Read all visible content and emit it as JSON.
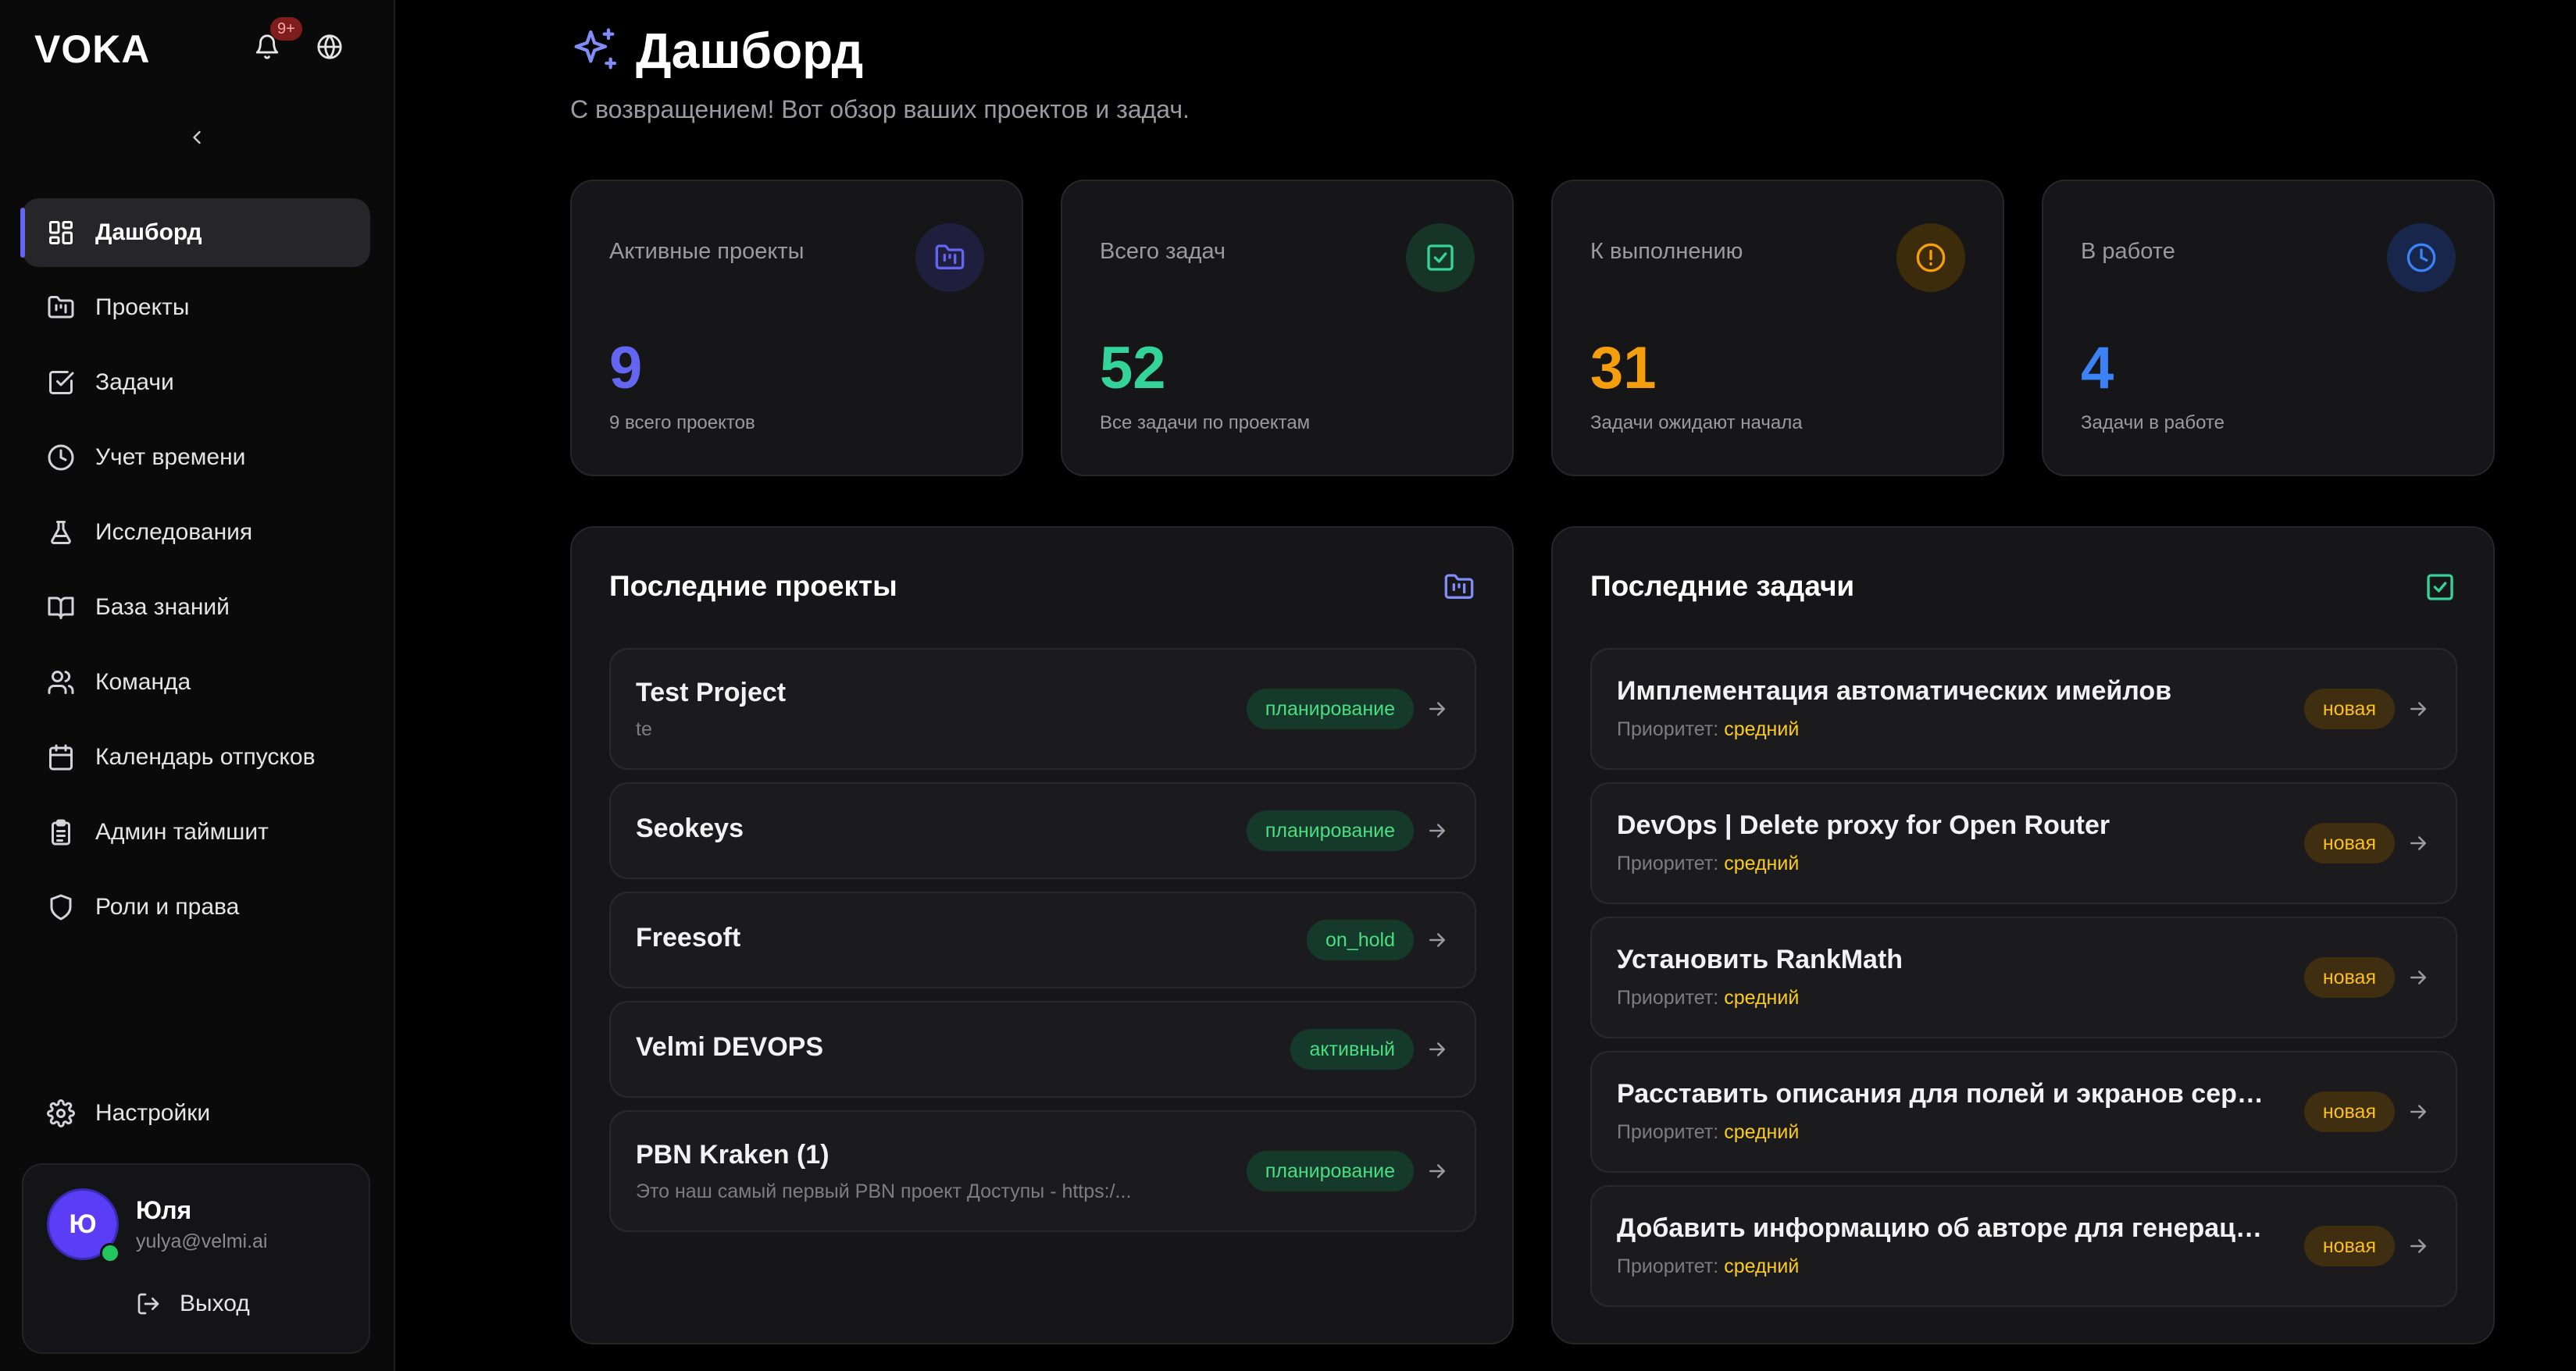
{
  "app": {
    "brand": "VOKA",
    "notifications_badge": "9+"
  },
  "sidebar": {
    "items": [
      {
        "label": "Дашборд",
        "icon": "dashboard-icon",
        "active": true
      },
      {
        "label": "Проекты",
        "icon": "folder-icon"
      },
      {
        "label": "Задачи",
        "icon": "task-check-icon"
      },
      {
        "label": "Учет времени",
        "icon": "clock-icon"
      },
      {
        "label": "Исследования",
        "icon": "flask-icon"
      },
      {
        "label": "База знаний",
        "icon": "book-icon"
      },
      {
        "label": "Команда",
        "icon": "users-icon"
      },
      {
        "label": "Календарь отпусков",
        "icon": "calendar-icon"
      },
      {
        "label": "Админ таймшит",
        "icon": "clipboard-icon"
      },
      {
        "label": "Роли и права",
        "icon": "shield-icon"
      }
    ],
    "settings_label": "Настройки",
    "user": {
      "initial": "Ю",
      "name": "Юля",
      "email": "yulya@velmi.ai",
      "logout_label": "Выход"
    }
  },
  "header": {
    "title": "Дашборд",
    "subtitle": "С возвращением! Вот обзор ваших проектов и задач."
  },
  "stats": [
    {
      "label": "Активные проекты",
      "value": "9",
      "sub": "9 всего проектов",
      "color": "#6366f1",
      "icon": "folder-kanban-icon"
    },
    {
      "label": "Всего задач",
      "value": "52",
      "sub": "Все задачи по проектам",
      "color": "#34d399",
      "icon": "check-square-icon"
    },
    {
      "label": "К выполнению",
      "value": "31",
      "sub": "Задачи ожидают начала",
      "color": "#f59e0b",
      "icon": "alert-circle-icon"
    },
    {
      "label": "В работе",
      "value": "4",
      "sub": "Задачи в работе",
      "color": "#3b82f6",
      "icon": "clock-icon"
    }
  ],
  "projects": {
    "title": "Последние проекты",
    "items": [
      {
        "name": "Test Project",
        "desc": "te",
        "status": "планирование"
      },
      {
        "name": "Seokeys",
        "desc": "",
        "status": "планирование"
      },
      {
        "name": "Freesoft",
        "desc": "",
        "status": "on_hold"
      },
      {
        "name": "Velmi DEVOPS",
        "desc": "",
        "status": "активный"
      },
      {
        "name": "PBN Kraken (1)",
        "desc": "Это наш самый первый PBN проект Доступы - https:/...",
        "status": "планирование"
      }
    ]
  },
  "tasks": {
    "title": "Последние задачи",
    "priority_label": "Приоритет:",
    "items": [
      {
        "name": "Имплементация автоматических имейлов",
        "priority": "средний",
        "status": "новая"
      },
      {
        "name": "DevOps | Delete proxy for Open Router",
        "priority": "средний",
        "status": "новая"
      },
      {
        "name": "Установить RankMath",
        "priority": "средний",
        "status": "новая"
      },
      {
        "name": "Расставить описания для полей и экранов сервис...",
        "priority": "средний",
        "status": "новая"
      },
      {
        "name": "Добавить информацию об авторе для генерации ...",
        "priority": "средний",
        "status": "новая"
      }
    ]
  }
}
